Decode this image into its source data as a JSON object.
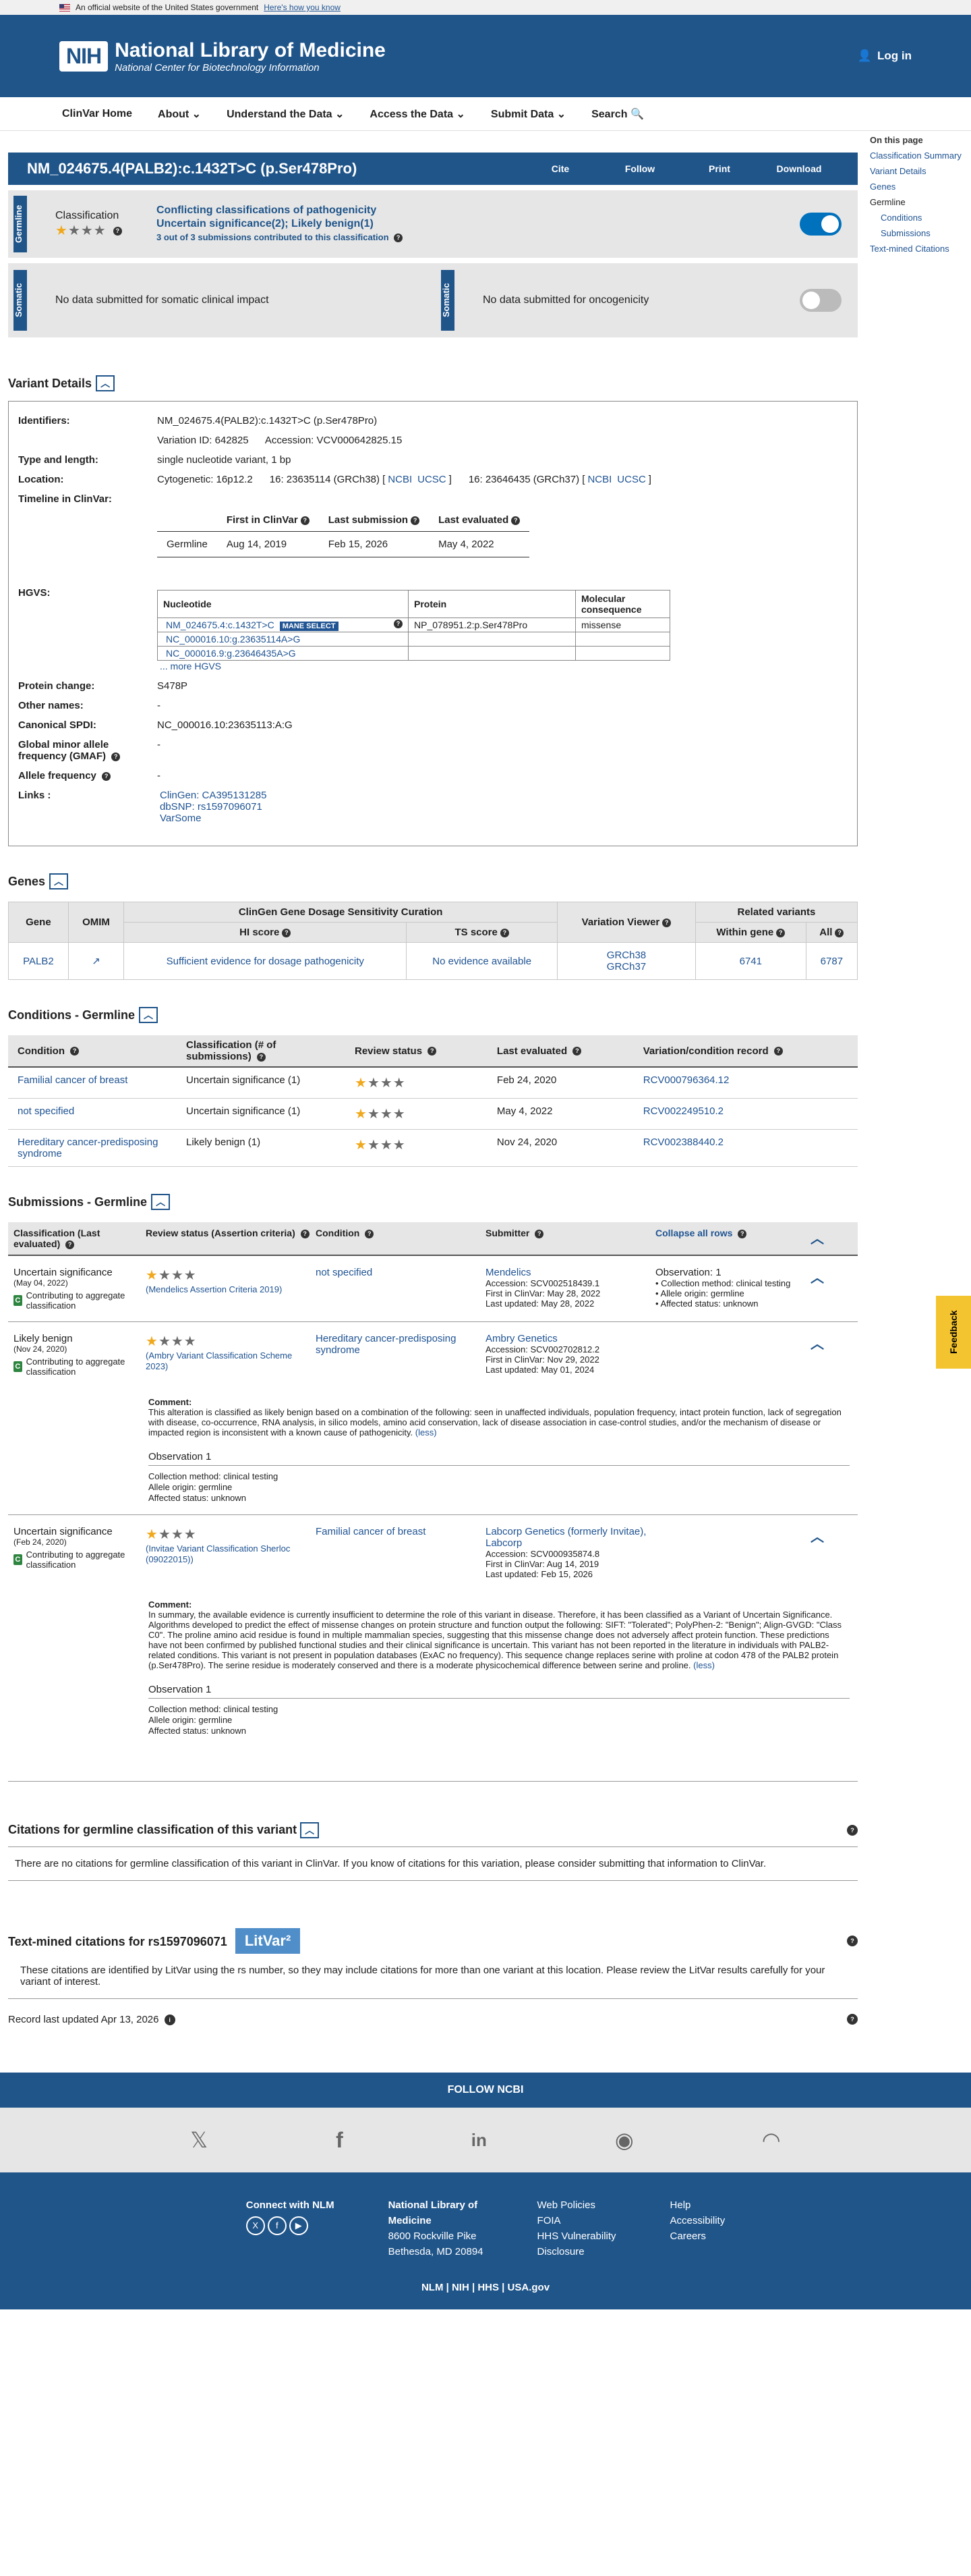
{
  "gov_banner": {
    "text": "An official website of the United States government",
    "link": "Here's how you know"
  },
  "header": {
    "logo": "NIH",
    "title": "National Library of Medicine",
    "subtitle": "National Center for Biotechnology Information",
    "login": "Log in"
  },
  "nav": [
    "ClinVar Home",
    "About",
    "Understand the Data",
    "Access the Data",
    "Submit Data",
    "Search"
  ],
  "toc": {
    "head": "On this page",
    "items": [
      "Classification Summary",
      "Variant Details",
      "Genes"
    ],
    "germline": "Germline",
    "sub": [
      "Conditions",
      "Submissions"
    ],
    "last": "Text-mined Citations"
  },
  "title": {
    "text": "NM_024675.4(PALB2):c.1432T>C (p.Ser478Pro)",
    "actions": [
      "Cite",
      "Follow",
      "Print",
      "Download"
    ]
  },
  "classification": {
    "tab": "Germline",
    "label": "Classification",
    "line1": "Conflicting classifications of pathogenicity",
    "line2": "Uncertain significance(2); Likely benign(1)",
    "line3": "3 out of 3 submissions contributed to this classification"
  },
  "somatic": {
    "tab": "Somatic",
    "left": "No data submitted for somatic clinical impact",
    "right": "No data submitted for oncogenicity"
  },
  "variant_details": {
    "heading": "Variant Details",
    "identifiers_k": "Identifiers:",
    "identifiers": "NM_024675.4(PALB2):c.1432T>C (p.Ser478Pro)",
    "ids": "Variation ID: 642825      Accession: VCV000642825.15",
    "type_k": "Type and length:",
    "type": "single nucleotide variant, 1 bp",
    "location_k": "Location:",
    "location": "Cytogenetic: 16p12.2      16: 23635114 (GRCh38) [",
    "loc2": "]      16: 23646435 (GRCh37) [",
    "loc_end": "]",
    "ncbi": "NCBI",
    "ucsc": "UCSC",
    "timeline_k": "Timeline in ClinVar:",
    "tl_headers": [
      "",
      "First in ClinVar",
      "Last submission",
      "Last evaluated"
    ],
    "tl_row": [
      "Germline",
      "Aug 14, 2019",
      "Feb 15, 2026",
      "May 4, 2022"
    ],
    "hgvs_k": "HGVS:",
    "hgvs_headers": [
      "Nucleotide",
      "Protein",
      "Molecular consequence"
    ],
    "hgvs_rows": [
      [
        "NM_024675.4:c.1432T>C",
        "NP_078951.2:p.Ser478Pro",
        "missense"
      ],
      [
        "NC_000016.10:g.23635114A>G",
        "",
        ""
      ],
      [
        "NC_000016.9:g.23646435A>G",
        "",
        ""
      ]
    ],
    "mane": "MANE SELECT",
    "more_hgvs": "... more HGVS",
    "protein_k": "Protein change:",
    "protein": "S478P",
    "other_k": "Other names:",
    "other": "-",
    "spdi_k": "Canonical SPDI:",
    "spdi": "NC_000016.10:23635113:A:G",
    "gmaf_k": "Global minor allele frequency (GMAF)",
    "gmaf": "-",
    "af_k": "Allele frequency",
    "af": "-",
    "links_k": "Links :",
    "links": [
      "ClinGen: CA395131285",
      "dbSNP: rs1597096071",
      "VarSome"
    ]
  },
  "genes": {
    "heading": "Genes",
    "top": [
      "Gene",
      "OMIM",
      "ClinGen Gene Dosage Sensitivity Curation",
      "Variation Viewer",
      "Related variants"
    ],
    "sub": [
      "HI score",
      "TS score",
      "Within gene",
      "All"
    ],
    "row": {
      "gene": "PALB2",
      "hi": "Sufficient evidence for dosage pathogenicity",
      "ts": "No evidence available",
      "vv1": "GRCh38",
      "vv2": "GRCh37",
      "within": "6741",
      "all": "6787"
    }
  },
  "conditions": {
    "heading": "Conditions - Germline",
    "headers": [
      "Condition",
      "Classification (# of submissions)",
      "Review status",
      "Last evaluated",
      "Variation/condition record"
    ],
    "rows": [
      [
        "Familial cancer of breast",
        "Uncertain significance (1)",
        "Feb 24, 2020",
        "RCV000796364.12"
      ],
      [
        "not specified",
        "Uncertain significance (1)",
        "May 4, 2022",
        "RCV002249510.2"
      ],
      [
        "Hereditary cancer-predisposing syndrome",
        "Likely benign (1)",
        "Nov 24, 2020",
        "RCV002388440.2"
      ]
    ]
  },
  "submissions": {
    "heading": "Submissions - Germline",
    "headers": [
      "Classification (Last evaluated)",
      "Review status (Assertion criteria)",
      "Condition",
      "Submitter",
      "Collapse all rows"
    ],
    "contrib": "Contributing to aggregate classification",
    "s1": {
      "cls": "Uncertain significance",
      "date": "(May 04, 2022)",
      "criteria": "(Mendelics Assertion Criteria 2019)",
      "cond": "not specified",
      "sub": "Mendelics",
      "acc": "Accession: SCV002518439.1",
      "first": "First in ClinVar: May 28, 2022",
      "upd": "Last updated: May 28, 2022",
      "obs": "Observation: 1",
      "o1": "• Collection method: clinical testing",
      "o2": "• Allele origin: germline",
      "o3": "• Affected status: unknown"
    },
    "s2": {
      "cls": "Likely benign",
      "date": "(Nov 24, 2020)",
      "criteria": "(Ambry Variant Classification Scheme 2023)",
      "cond": "Hereditary cancer-predisposing syndrome",
      "sub": "Ambry Genetics",
      "acc": "Accession: SCV002702812.2",
      "first": "First in ClinVar: Nov 29, 2022",
      "upd": "Last updated: May 01, 2024",
      "comment_h": "Comment:",
      "comment": "This alteration is classified as likely benign based on a combination of the following: seen in unaffected individuals, population frequency, intact protein function, lack of segregation with disease, co-occurrence, RNA analysis, in silico models, amino acid conservation, lack of disease association in case-control studies, and/or the mechanism of disease or impacted region is inconsistent with a known cause of pathogenicity.",
      "less": "(less)",
      "obs_h": "Observation 1",
      "o1": "Collection method: clinical testing",
      "o2": "Allele origin: germline",
      "o3": "Affected status: unknown"
    },
    "s3": {
      "cls": "Uncertain significance",
      "date": "(Feb 24, 2020)",
      "criteria": "(Invitae Variant Classification Sherloc (09022015))",
      "cond": "Familial cancer of breast",
      "sub": "Labcorp Genetics (formerly Invitae), Labcorp",
      "acc": "Accession: SCV000935874.8",
      "first": "First in ClinVar: Aug 14, 2019",
      "upd": "Last updated: Feb 15, 2026",
      "comment_h": "Comment:",
      "comment": "In summary, the available evidence is currently insufficient to determine the role of this variant in disease. Therefore, it has been classified as a Variant of Uncertain Significance. Algorithms developed to predict the effect of missense changes on protein structure and function output the following: SIFT: \"Tolerated\"; PolyPhen-2: \"Benign\"; Align-GVGD: \"Class C0\". The proline amino acid residue is found in multiple mammalian species, suggesting that this missense change does not adversely affect protein function. These predictions have not been confirmed by published functional studies and their clinical significance is uncertain. This variant has not been reported in the literature in individuals with PALB2-related conditions. This variant is not present in population databases (ExAC no frequency). This sequence change replaces serine with proline at codon 478 of the PALB2 protein (p.Ser478Pro). The serine residue is moderately conserved and there is a moderate physicochemical difference between serine and proline.",
      "less": "(less)",
      "obs_h": "Observation 1",
      "o1": "Collection method: clinical testing",
      "o2": "Allele origin: germline",
      "o3": "Affected status: unknown"
    }
  },
  "citations": {
    "heading": "Citations for germline classification of this variant",
    "text": "There are no citations for germline classification of this variant in ClinVar. If you know of citations for this variation, please consider submitting that information to ClinVar."
  },
  "textmined": {
    "heading": "Text-mined citations for rs1597096071",
    "litvar": "LitVar²",
    "text": "These citations are identified by LitVar using the rs number, so they may include citations for more than one variant at this location. Please review the LitVar results carefully for your variant of interest."
  },
  "record": "Record last updated Apr 13, 2026",
  "feedback": "Feedback",
  "footer": {
    "follow": "FOLLOW NCBI",
    "connect": "Connect with NLM",
    "addr": [
      "National Library of",
      "Medicine",
      "8600 Rockville Pike",
      "Bethesda, MD 20894"
    ],
    "col3": [
      "Web Policies",
      "FOIA",
      "HHS Vulnerability",
      "Disclosure"
    ],
    "col4": [
      "Help",
      "Accessibility",
      "Careers"
    ],
    "bottom": "NLM | NIH | HHS | USA.gov"
  }
}
